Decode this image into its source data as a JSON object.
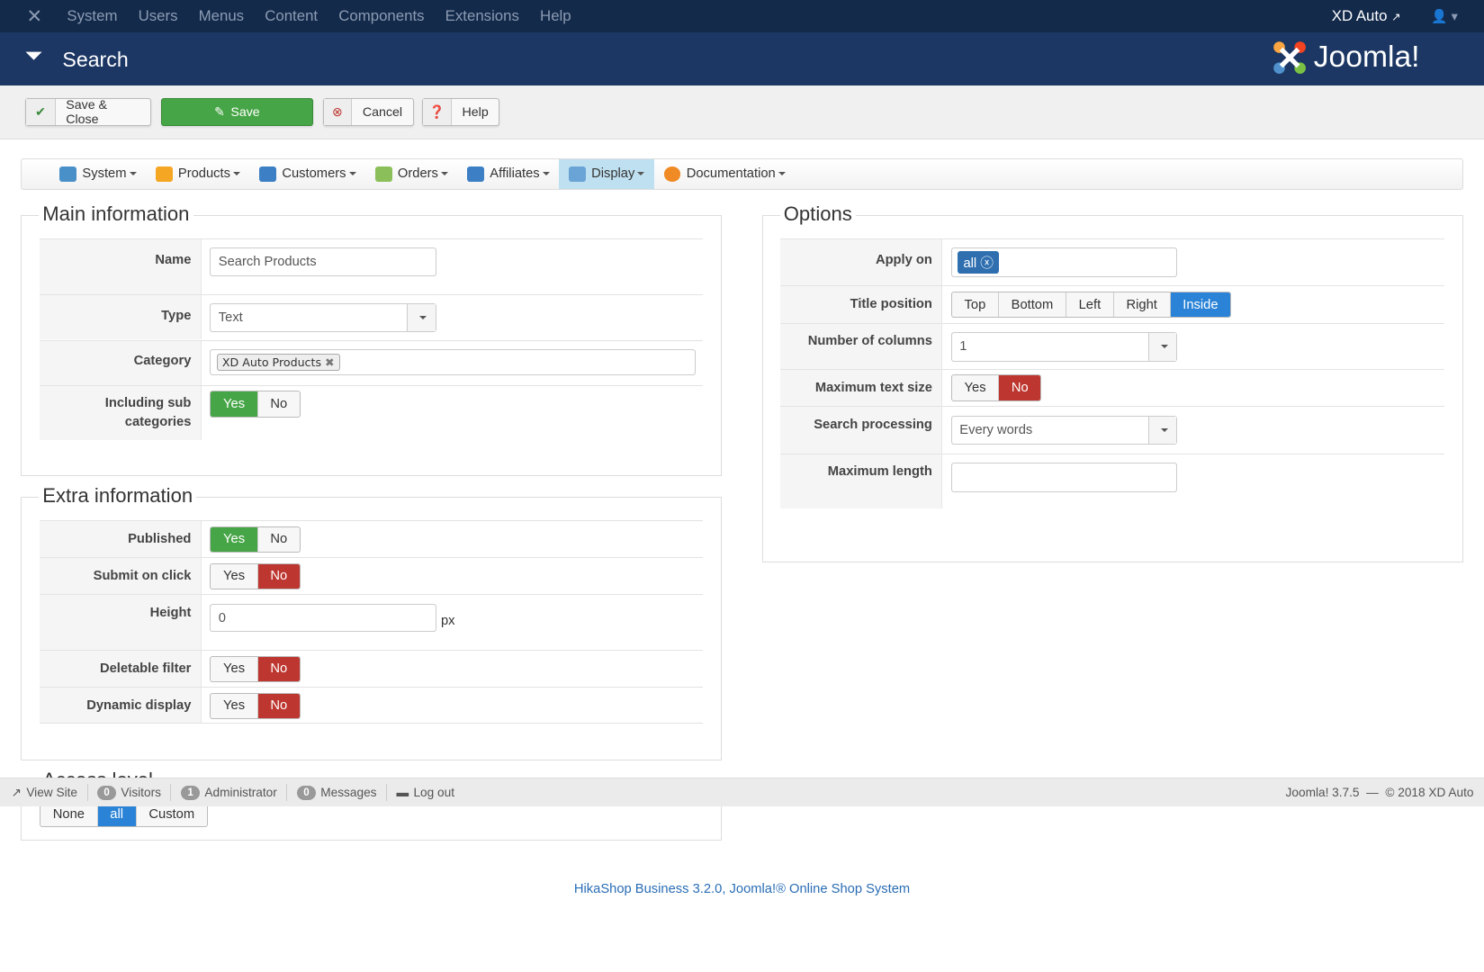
{
  "topnav": {
    "items": [
      "System",
      "Users",
      "Menus",
      "Content",
      "Components",
      "Extensions",
      "Help"
    ],
    "site": "XD Auto"
  },
  "header": {
    "title": "Search",
    "brand": "Joomla!"
  },
  "toolbar": {
    "save_close": "Save & Close",
    "save": "Save",
    "cancel": "Cancel",
    "help": "Help"
  },
  "subnav": {
    "items": [
      {
        "label": "System",
        "color": "#4a90c8"
      },
      {
        "label": "Products",
        "color": "#f5a623"
      },
      {
        "label": "Customers",
        "color": "#3c7fc4"
      },
      {
        "label": "Orders",
        "color": "#8bbf5a"
      },
      {
        "label": "Affiliates",
        "color": "#3c7fc4"
      },
      {
        "label": "Display",
        "color": "#6aa3d6"
      },
      {
        "label": "Documentation",
        "color": "#f08a24"
      }
    ]
  },
  "main_info": {
    "legend": "Main information",
    "name_label": "Name",
    "name_value": "Search Products",
    "type_label": "Type",
    "type_value": "Text",
    "category_label": "Category",
    "category_tag": "XD Auto Products",
    "sub_label": "Including sub categories",
    "yes": "Yes",
    "no": "No"
  },
  "extra_info": {
    "legend": "Extra information",
    "published": "Published",
    "submit": "Submit on click",
    "height": "Height",
    "height_value": "0",
    "px": "px",
    "deletable": "Deletable filter",
    "dynamic": "Dynamic display",
    "yes": "Yes",
    "no": "No"
  },
  "access": {
    "legend": "Access level",
    "none": "None",
    "all": "all",
    "custom": "Custom"
  },
  "options": {
    "legend": "Options",
    "apply_label": "Apply on",
    "apply_tag": "all",
    "title_label": "Title position",
    "positions": [
      "Top",
      "Bottom",
      "Left",
      "Right",
      "Inside"
    ],
    "columns_label": "Number of columns",
    "columns_value": "1",
    "maxtext_label": "Maximum text size",
    "yes": "Yes",
    "no": "No",
    "processing_label": "Search processing",
    "processing_value": "Every words",
    "maxlen_label": "Maximum length",
    "maxlen_value": ""
  },
  "statusbar": {
    "view_site": "View Site",
    "visitors_count": "0",
    "visitors": "Visitors",
    "admin_count": "1",
    "admin": "Administrator",
    "messages_count": "0",
    "messages": "Messages",
    "logout": "Log out",
    "version": "Joomla! 3.7.5  —  © 2018 XD Auto"
  },
  "footer": {
    "link": "HikaShop Business 3.2.0, Joomla!® Online Shop System"
  }
}
